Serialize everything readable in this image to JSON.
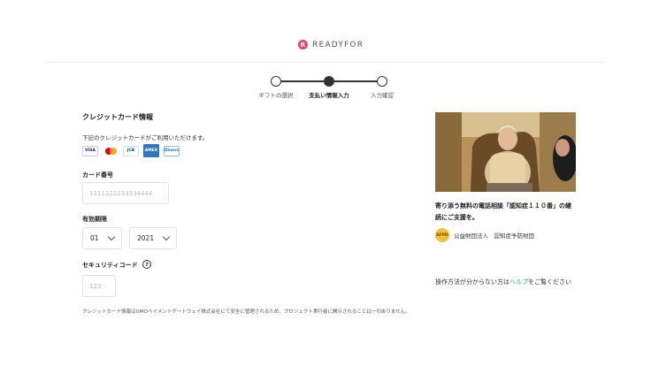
{
  "header": {
    "logo_mark": "R",
    "logo_text": "READYFOR"
  },
  "stepper": {
    "steps": [
      {
        "label": "ギフトの選択",
        "active": false
      },
      {
        "label": "支払い情報入力",
        "active": true
      },
      {
        "label": "入力確認",
        "active": false
      }
    ]
  },
  "payment": {
    "section_title": "クレジットカード情報",
    "accept_text": "下記のクレジットカードがご利用いただけます。",
    "card_brands": [
      {
        "name": "visa",
        "label": "VISA"
      },
      {
        "name": "mastercard",
        "label": ""
      },
      {
        "name": "jcb",
        "label": "JCB"
      },
      {
        "name": "amex",
        "label": "AMEX"
      },
      {
        "name": "diners",
        "label": "Diners"
      }
    ],
    "card_number_label": "カード番号",
    "card_number_placeholder": "1111222233334444",
    "card_number_value": "",
    "expiry_label": "有効期限",
    "expiry_month": "01",
    "expiry_year": "2021",
    "security_code_label": "セキュリティコード",
    "security_help_icon": "?",
    "security_code_placeholder": "123",
    "security_code_value": "",
    "notice": "クレジットカード情報はGMOペイメントゲートウェイ株式会社にて安全に管理されるため、プロジェクト実行者に開示されることは一切ありません。"
  },
  "project": {
    "title": "寄り添う無料の電話相談「認知症１１０番」の継続にご支援を。",
    "org_avatar_text": "AFPD",
    "org_name": "公益財団法人　認知症予防財団"
  },
  "help": {
    "prefix": "操作方法が分からない方は",
    "link": "ヘルプ",
    "suffix": "をご覧ください"
  },
  "colors": {
    "brand": "#e0456b",
    "link": "#2a9d8f",
    "stepper": "#333333"
  }
}
